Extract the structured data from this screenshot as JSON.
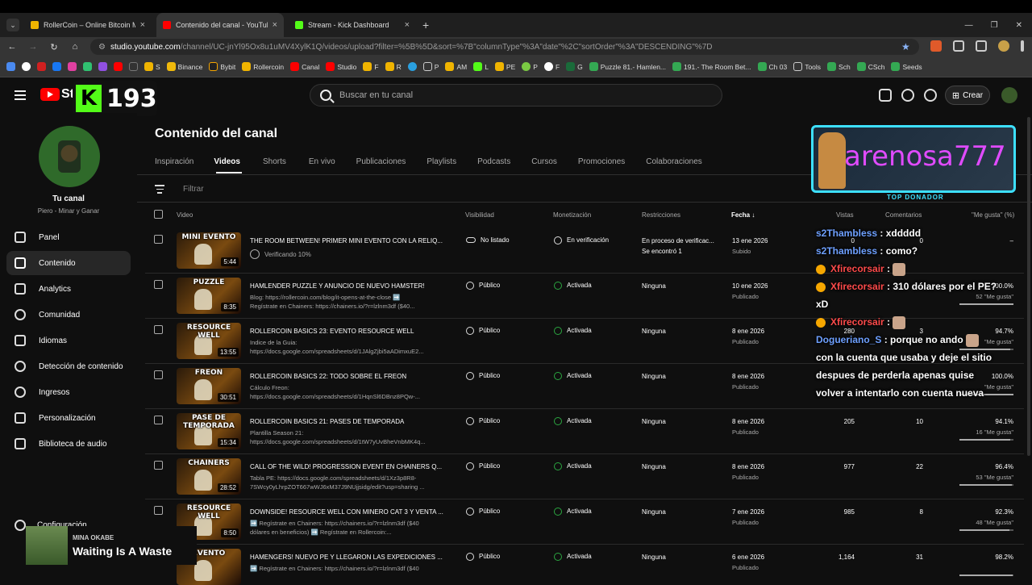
{
  "browser": {
    "tabs": [
      {
        "title": "RollerCoin – Online Bitcoin Mining",
        "color": "#f0b400"
      },
      {
        "title": "Contenido del canal - YouTube",
        "color": "#ff0000"
      },
      {
        "title": "Stream - Kick Dashboard",
        "color": "#53fc18"
      }
    ],
    "url_host": "studio.youtube.com",
    "url_path": "/channel/UC-jnYl95Ox8u1uMV4XylK1Q/videos/upload?filter=%5B%5D&sort=%7B\"columnType\"%3A\"date\"%2C\"sortOrder\"%3A\"DESCENDING\"%7D",
    "bookmarks": [
      "S",
      "Binance",
      "Bybit",
      "Rollercoin",
      "Canal",
      "Studio",
      "F",
      "R",
      "P",
      "AM",
      "L",
      "PE",
      "P",
      "F",
      "G",
      "Puzzle 81.- Hamlen...",
      "191.- The Room Bet...",
      "Ch 03",
      "Tools",
      "Sch",
      "CSch",
      "Seeds"
    ]
  },
  "kick": {
    "count": "193"
  },
  "header": {
    "search_placeholder": "Buscar en tu canal",
    "create_label": "Crear"
  },
  "sidebar": {
    "channel_title": "Tu canal",
    "channel_subtitle": "Piero - Minar y Ganar",
    "items": [
      "Panel",
      "Contenido",
      "Analytics",
      "Comunidad",
      "Idiomas",
      "Detección de contenido",
      "Ingresos",
      "Personalización",
      "Biblioteca de audio"
    ],
    "config_label": "Configuración"
  },
  "content": {
    "title": "Contenido del canal",
    "tabs": [
      "Inspiración",
      "Videos",
      "Shorts",
      "En vivo",
      "Publicaciones",
      "Playlists",
      "Podcasts",
      "Cursos",
      "Promociones",
      "Colaboraciones"
    ],
    "filter_label": "Filtrar",
    "columns": {
      "video": "Video",
      "visibility": "Visibilidad",
      "monetization": "Monetización",
      "restrictions": "Restricciones",
      "date": "Fecha",
      "views": "Vistas",
      "comments": "Comentarios",
      "likes": "\"Me gusta\" (%)"
    },
    "rows": [
      {
        "thumb": "MINI EVENTO",
        "duration": "5:44",
        "title": "THE ROOM BETWEEN! PRIMER MINI EVENTO CON LA RELIQ...",
        "desc1": "",
        "desc2": "",
        "verifying": "Verificando 10%",
        "visibility": "No listado",
        "monetization": "En verificación",
        "restriction1": "En proceso de verificac...",
        "restriction2": "Se encontró 1",
        "date": "13 ene 2026",
        "status": "Subido",
        "views": "0",
        "comments": "0",
        "likes": "–",
        "likes_sub": "",
        "like_pct": 0
      },
      {
        "thumb": "PUZZLE",
        "duration": "8:35",
        "title": "HAMLENDER PUZZLE Y ANUNCIO DE NUEVO HAMSTER!",
        "desc1": "Blog: https://rollercoin.com/blog/it-opens-at-the-close ➡️",
        "desc2": "Regístrate en Chainers: https://chainers.io/?r=lzlnm3df ($40...",
        "verifying": "",
        "visibility": "Público",
        "monetization": "Activada",
        "restriction1": "Ninguna",
        "restriction2": "",
        "date": "10 ene 2026",
        "status": "Publicado",
        "views": "",
        "comments": "",
        "likes": "100.0%",
        "likes_sub": "52 \"Me gusta\"",
        "like_pct": 1
      },
      {
        "thumb": "RESOURCE WELL",
        "duration": "13:55",
        "title": "ROLLERCOIN BASICS 23: EVENTO RESOURCE WELL",
        "desc1": "Indice de la Guia:",
        "desc2": "https://docs.google.com/spreadsheets/d/1JAlgZjbi5aADimxuE2...",
        "verifying": "",
        "visibility": "Público",
        "monetization": "Activada",
        "restriction1": "Ninguna",
        "restriction2": "",
        "date": "8 ene 2026",
        "status": "Publicado",
        "views": "280",
        "comments": "3",
        "likes": "94.7%",
        "likes_sub": "\"Me gusta\"",
        "like_pct": 0.947
      },
      {
        "thumb": "FREON",
        "duration": "30:51",
        "title": "ROLLERCOIN BASICS 22: TODO SOBRE EL FREON",
        "desc1": "Cálculo Freon:",
        "desc2": "https://docs.google.com/spreadsheets/d/1HqnSl6DBnz8PQw-...",
        "verifying": "",
        "visibility": "Público",
        "monetization": "Activada",
        "restriction1": "Ninguna",
        "restriction2": "",
        "date": "8 ene 2026",
        "status": "Publicado",
        "views": "",
        "comments": "",
        "likes": "100.0%",
        "likes_sub": "\"Me gusta\"",
        "like_pct": 1
      },
      {
        "thumb": "PASE DE TEMPORADA",
        "duration": "15:34",
        "title": "ROLLERCOIN BASICS 21: PASES DE TEMPORADA",
        "desc1": "Plantilla Season 21:",
        "desc2": "https://docs.google.com/spreadsheets/d/1tW7yUvBheVnbMK4q...",
        "verifying": "",
        "visibility": "Público",
        "monetization": "Activada",
        "restriction1": "Ninguna",
        "restriction2": "",
        "date": "8 ene 2026",
        "status": "Publicado",
        "views": "205",
        "comments": "10",
        "likes": "94.1%",
        "likes_sub": "16 \"Me gusta\"",
        "like_pct": 0.941
      },
      {
        "thumb": "CHAINERS",
        "duration": "28:52",
        "title": "CALL OF THE WILD! PROGRESSION EVENT EN CHAINERS Q...",
        "desc1": "Tabla PE: https://docs.google.com/spreadsheets/d/1Xz3p8R8-",
        "desc2": "7SWcy0yLhrpZOT667wWJ6xM37J9NUjjsidg/edit?usp=sharing ...",
        "verifying": "",
        "visibility": "Público",
        "monetization": "Activada",
        "restriction1": "Ninguna",
        "restriction2": "",
        "date": "8 ene 2026",
        "status": "Publicado",
        "views": "977",
        "comments": "22",
        "likes": "96.4%",
        "likes_sub": "53 \"Me gusta\"",
        "like_pct": 0.964
      },
      {
        "thumb": "RESOURCE WELL",
        "duration": "8:50",
        "title": "DOWNSIDE! RESOURCE WELL CON MINERO CAT 3 Y VENTA ...",
        "desc1": "➡️ Regístrate en Chainers: https://chainers.io/?r=lzlnm3df ($40",
        "desc2": "dólares en beneficios) ➡️ Regístrate en Rollercoin:...",
        "verifying": "",
        "visibility": "Público",
        "monetization": "Activada",
        "restriction1": "Ninguna",
        "restriction2": "",
        "date": "7 ene 2026",
        "status": "Publicado",
        "views": "985",
        "comments": "8",
        "likes": "92.3%",
        "likes_sub": "48 \"Me gusta\"",
        "like_pct": 0.923
      },
      {
        "thumb": "EVENTO",
        "duration": "",
        "title": "HAMENGERS! NUEVO PE Y LLEGARON LAS EXPEDICIONES ...",
        "desc1": "➡️ Regístrate en Chainers: https://chainers.io/?r=lzlnm3df ($40",
        "desc2": "",
        "verifying": "",
        "visibility": "Público",
        "monetization": "Activada",
        "restriction1": "Ninguna",
        "restriction2": "",
        "date": "6 ene 2026",
        "status": "Publicado",
        "views": "1,164",
        "comments": "31",
        "likes": "98.2%",
        "likes_sub": "",
        "like_pct": 0.982
      }
    ]
  },
  "overlay": {
    "donor_name": "arenosa777",
    "donor_label": "TOP DONADOR",
    "chat": [
      {
        "user": "s2Thambless",
        "text": ": xddddd",
        "cls": "u-blue",
        "badge": false,
        "emo": false
      },
      {
        "user": "s2Thambless",
        "text": ": como?",
        "cls": "u-blue",
        "badge": false,
        "emo": false
      },
      {
        "user": "Xfirecorsair",
        "text": ":",
        "cls": "u-red",
        "badge": true,
        "emo": true
      },
      {
        "user": "Xfirecorsair",
        "text": ": 310 dólares por el PE?",
        "cls": "u-red",
        "badge": true,
        "emo": false
      },
      {
        "user": "",
        "text": "xD",
        "cls": "",
        "badge": false,
        "emo": false
      },
      {
        "user": "Xfirecorsair",
        "text": ":",
        "cls": "u-red",
        "badge": true,
        "emo": true
      },
      {
        "user": "Dogueriano_S",
        "text": ": porque no ando",
        "cls": "u-blue",
        "badge": false,
        "emo": true
      },
      {
        "user": "",
        "text": "con la cuenta que usaba y deje el sitio",
        "cls": "",
        "badge": false,
        "emo": false
      },
      {
        "user": "",
        "text": "despues de perderla apenas quise",
        "cls": "",
        "badge": false,
        "emo": false
      },
      {
        "user": "",
        "text": "volver a intentarlo con cuenta nueva",
        "cls": "",
        "badge": false,
        "emo": false
      }
    ],
    "music": {
      "artist": "MINA OKABE",
      "song": "Waiting Is A Waste"
    }
  }
}
